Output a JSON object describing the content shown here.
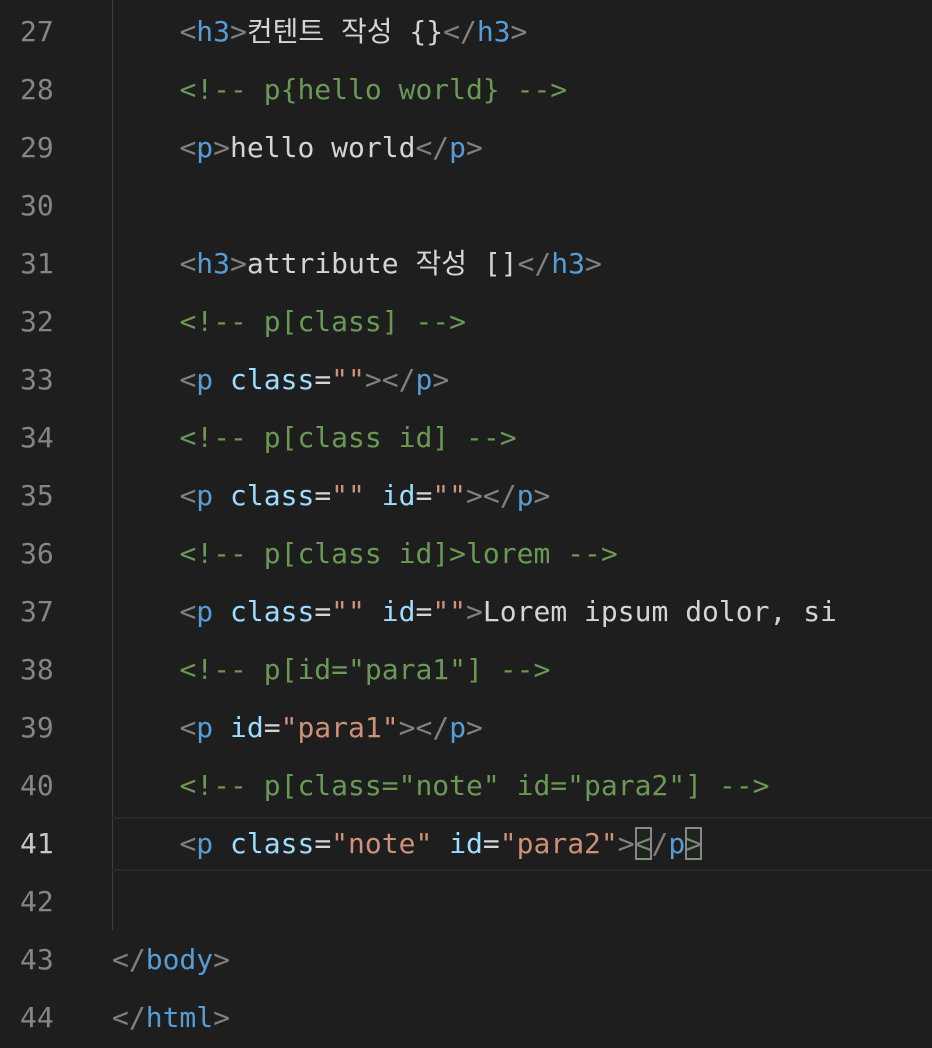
{
  "editor": {
    "active_line": 41,
    "lines": [
      {
        "number": "27",
        "tokens": [
          {
            "t": "    ",
            "k": "text"
          },
          {
            "t": "<",
            "k": "bracket"
          },
          {
            "t": "h3",
            "k": "tag"
          },
          {
            "t": ">",
            "k": "bracket"
          },
          {
            "t": "컨텐트 작성 {}",
            "k": "text"
          },
          {
            "t": "</",
            "k": "bracket"
          },
          {
            "t": "h3",
            "k": "tag"
          },
          {
            "t": ">",
            "k": "bracket"
          }
        ]
      },
      {
        "number": "28",
        "tokens": [
          {
            "t": "    ",
            "k": "text"
          },
          {
            "t": "<!-- p{hello world} -->",
            "k": "comment"
          }
        ]
      },
      {
        "number": "29",
        "tokens": [
          {
            "t": "    ",
            "k": "text"
          },
          {
            "t": "<",
            "k": "bracket"
          },
          {
            "t": "p",
            "k": "tag"
          },
          {
            "t": ">",
            "k": "bracket"
          },
          {
            "t": "hello world",
            "k": "text"
          },
          {
            "t": "</",
            "k": "bracket"
          },
          {
            "t": "p",
            "k": "tag"
          },
          {
            "t": ">",
            "k": "bracket"
          }
        ]
      },
      {
        "number": "30",
        "tokens": []
      },
      {
        "number": "31",
        "tokens": [
          {
            "t": "    ",
            "k": "text"
          },
          {
            "t": "<",
            "k": "bracket"
          },
          {
            "t": "h3",
            "k": "tag"
          },
          {
            "t": ">",
            "k": "bracket"
          },
          {
            "t": "attribute 작성 []",
            "k": "text"
          },
          {
            "t": "</",
            "k": "bracket"
          },
          {
            "t": "h3",
            "k": "tag"
          },
          {
            "t": ">",
            "k": "bracket"
          }
        ]
      },
      {
        "number": "32",
        "tokens": [
          {
            "t": "    ",
            "k": "text"
          },
          {
            "t": "<!-- p[class] -->",
            "k": "comment"
          }
        ]
      },
      {
        "number": "33",
        "tokens": [
          {
            "t": "    ",
            "k": "text"
          },
          {
            "t": "<",
            "k": "bracket"
          },
          {
            "t": "p",
            "k": "tag"
          },
          {
            "t": " ",
            "k": "text"
          },
          {
            "t": "class",
            "k": "attr"
          },
          {
            "t": "=",
            "k": "text"
          },
          {
            "t": "\"\"",
            "k": "str"
          },
          {
            "t": "></",
            "k": "bracket"
          },
          {
            "t": "p",
            "k": "tag"
          },
          {
            "t": ">",
            "k": "bracket"
          }
        ]
      },
      {
        "number": "34",
        "tokens": [
          {
            "t": "    ",
            "k": "text"
          },
          {
            "t": "<!-- p[class id] -->",
            "k": "comment"
          }
        ]
      },
      {
        "number": "35",
        "tokens": [
          {
            "t": "    ",
            "k": "text"
          },
          {
            "t": "<",
            "k": "bracket"
          },
          {
            "t": "p",
            "k": "tag"
          },
          {
            "t": " ",
            "k": "text"
          },
          {
            "t": "class",
            "k": "attr"
          },
          {
            "t": "=",
            "k": "text"
          },
          {
            "t": "\"\"",
            "k": "str"
          },
          {
            "t": " ",
            "k": "text"
          },
          {
            "t": "id",
            "k": "attr"
          },
          {
            "t": "=",
            "k": "text"
          },
          {
            "t": "\"\"",
            "k": "str"
          },
          {
            "t": "></",
            "k": "bracket"
          },
          {
            "t": "p",
            "k": "tag"
          },
          {
            "t": ">",
            "k": "bracket"
          }
        ]
      },
      {
        "number": "36",
        "tokens": [
          {
            "t": "    ",
            "k": "text"
          },
          {
            "t": "<!-- p[class id]>lorem -->",
            "k": "comment"
          }
        ]
      },
      {
        "number": "37",
        "tokens": [
          {
            "t": "    ",
            "k": "text"
          },
          {
            "t": "<",
            "k": "bracket"
          },
          {
            "t": "p",
            "k": "tag"
          },
          {
            "t": " ",
            "k": "text"
          },
          {
            "t": "class",
            "k": "attr"
          },
          {
            "t": "=",
            "k": "text"
          },
          {
            "t": "\"\"",
            "k": "str"
          },
          {
            "t": " ",
            "k": "text"
          },
          {
            "t": "id",
            "k": "attr"
          },
          {
            "t": "=",
            "k": "text"
          },
          {
            "t": "\"\"",
            "k": "str"
          },
          {
            "t": ">",
            "k": "bracket"
          },
          {
            "t": "Lorem ipsum dolor, si",
            "k": "text"
          }
        ]
      },
      {
        "number": "38",
        "tokens": [
          {
            "t": "    ",
            "k": "text"
          },
          {
            "t": "<!-- p[id=\"para1\"] -->",
            "k": "comment"
          }
        ]
      },
      {
        "number": "39",
        "tokens": [
          {
            "t": "    ",
            "k": "text"
          },
          {
            "t": "<",
            "k": "bracket"
          },
          {
            "t": "p",
            "k": "tag"
          },
          {
            "t": " ",
            "k": "text"
          },
          {
            "t": "id",
            "k": "attr"
          },
          {
            "t": "=",
            "k": "text"
          },
          {
            "t": "\"para1\"",
            "k": "str"
          },
          {
            "t": "></",
            "k": "bracket"
          },
          {
            "t": "p",
            "k": "tag"
          },
          {
            "t": ">",
            "k": "bracket"
          }
        ]
      },
      {
        "number": "40",
        "tokens": [
          {
            "t": "    ",
            "k": "text"
          },
          {
            "t": "<!-- p[class=\"note\" id=\"para2\"] -->",
            "k": "comment"
          }
        ]
      },
      {
        "number": "41",
        "tokens": [
          {
            "t": "    ",
            "k": "text"
          },
          {
            "t": "<",
            "k": "bracket"
          },
          {
            "t": "p",
            "k": "tag"
          },
          {
            "t": " ",
            "k": "text"
          },
          {
            "t": "class",
            "k": "attr"
          },
          {
            "t": "=",
            "k": "text"
          },
          {
            "t": "\"note\"",
            "k": "str"
          },
          {
            "t": " ",
            "k": "text"
          },
          {
            "t": "id",
            "k": "attr"
          },
          {
            "t": "=",
            "k": "text"
          },
          {
            "t": "\"para2\"",
            "k": "str"
          },
          {
            "t": ">",
            "k": "bracket"
          },
          {
            "t": "<",
            "k": "bracket",
            "match": true
          },
          {
            "t": "/",
            "k": "bracket"
          },
          {
            "t": "p",
            "k": "tag"
          },
          {
            "t": ">",
            "k": "bracket",
            "match": true
          }
        ]
      },
      {
        "number": "42",
        "tokens": []
      },
      {
        "number": "43",
        "tokens": [
          {
            "t": "</",
            "k": "bracket"
          },
          {
            "t": "body",
            "k": "tag"
          },
          {
            "t": ">",
            "k": "bracket"
          }
        ]
      },
      {
        "number": "44",
        "tokens": [
          {
            "t": "</",
            "k": "bracket"
          },
          {
            "t": "html",
            "k": "tag"
          },
          {
            "t": ">",
            "k": "bracket"
          }
        ]
      }
    ]
  },
  "colors": {
    "background": "#1e1e1e",
    "line_number": "#858585",
    "line_number_active": "#c6c6c6",
    "bracket": "#808080",
    "tag": "#569cd6",
    "attribute": "#9cdcfe",
    "string": "#ce9178",
    "comment": "#6a9955",
    "text": "#d4d4d4"
  }
}
